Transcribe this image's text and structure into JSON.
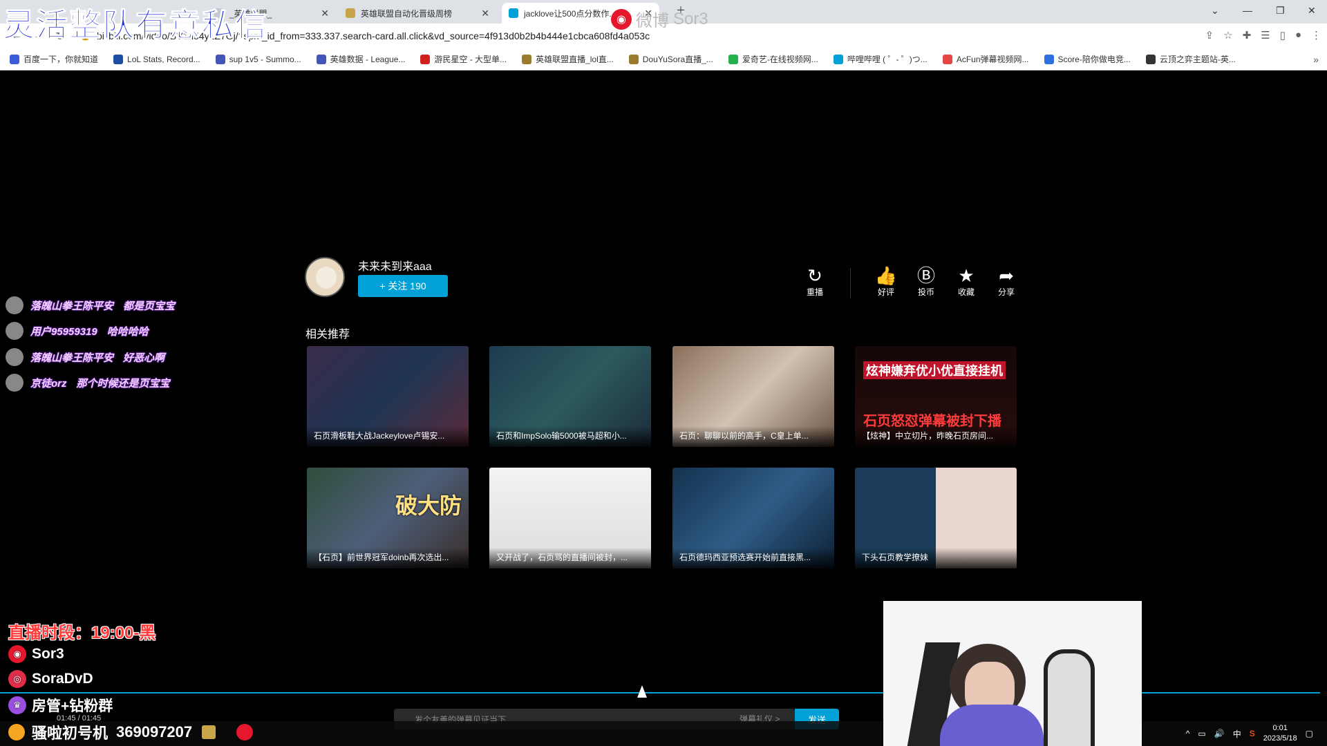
{
  "overlay": {
    "title": "灵活整队有意私信",
    "weibo_badge": "微博",
    "weibo_name": "Sor3"
  },
  "browser": {
    "tabs": [
      {
        "label": "_英雄联盟_"
      },
      {
        "label": "英雄联盟自动化晋级周榜"
      },
      {
        "label": "jacklove让500点分数作..."
      }
    ],
    "url": "bilibili.com/video/BV1h54y1Z7Gj/?spm_id_from=333.337.search-card.all.click&vd_source=4f913d0b2b4b444e1cbca608fd4a053c",
    "bookmarks": [
      {
        "label": "百度一下，你就知道",
        "color": "#3b5bdb"
      },
      {
        "label": "LoL Stats, Record...",
        "color": "#1c4fa3"
      },
      {
        "label": "sup 1v5 - Summo...",
        "color": "#4256b8"
      },
      {
        "label": "英雄数据 - League...",
        "color": "#4256b8"
      },
      {
        "label": "游民星空 - 大型单...",
        "color": "#d01f1f"
      },
      {
        "label": "英雄联盟直播_lol直...",
        "color": "#9a7b2d"
      },
      {
        "label": "DouYuSora直播_...",
        "color": "#9a7b2d"
      },
      {
        "label": "爱奇艺-在线视频网...",
        "color": "#22b14c"
      },
      {
        "label": "哔哩哔哩 ( ゜- ゜)つ...",
        "color": "#00a1d6"
      },
      {
        "label": "AcFun弹幕视频网...",
        "color": "#e44545"
      },
      {
        "label": "Score-陪你做电竞...",
        "color": "#2f6fe0"
      },
      {
        "label": "云顶之弈主题站-英...",
        "color": "#333333"
      }
    ]
  },
  "uploader": {
    "name": "未来未到来aaa",
    "follow_label": "+ 关注 190"
  },
  "actions": {
    "replay": "重播",
    "like": "好评",
    "coin": "投币",
    "favorite": "收藏",
    "share": "分享"
  },
  "related": {
    "title": "相关推荐",
    "videos": [
      {
        "caption": "石页滑板鞋大战Jackeylove卢锡安...",
        "bg": "linear-gradient(135deg,#3a2b4a,#1f3553 50%,#5b2a3a)",
        "overlay_text": ""
      },
      {
        "caption": "石页和ImpSolo输5000被马超和小...",
        "bg": "linear-gradient(135deg,#1e3b4f,#2c5a5e 50%,#1b2c3a)",
        "overlay_text": ""
      },
      {
        "caption": "石页：聊聊以前的高手，C皇上单...",
        "bg": "linear-gradient(135deg,#8a6f5a,#d2c2b2 50%,#6b5443)",
        "overlay_text": ""
      },
      {
        "caption": "【炫神】中立切片，昨晚石页房间...",
        "bg": "linear-gradient(180deg,#140808,#2a0d0d)",
        "overlay_text": "炫神嫌弃优小优直接挂机",
        "overlay_text2": "石页怒怼弹幕被封下播"
      },
      {
        "caption": "【石页】前世界冠军doinb再次选出...",
        "bg": "linear-gradient(135deg,#2e4d3a,#4d5f7a 50%,#3a2e2a)",
        "overlay_text": "破大防"
      },
      {
        "caption": "又开战了，石页骂的直播间被封，...",
        "bg": "linear-gradient(180deg,#f3f3f3,#dcdcdc)",
        "overlay_text": ""
      },
      {
        "caption": "石页德玛西亚预选赛开始前直接黑...",
        "bg": "linear-gradient(135deg,#13324f,#2f5c86 50%,#0d2136)",
        "overlay_text": ""
      },
      {
        "caption": "下头石页教学撩妹",
        "bg": "linear-gradient(90deg,#1a3c5a 50%,#e8d6cf 50%)",
        "overlay_text": ""
      }
    ]
  },
  "danmaku": [
    {
      "user": "落魄山拳王陈平安",
      "msg": "都是页宝宝"
    },
    {
      "user": "用户95959319",
      "msg": "哈哈哈哈"
    },
    {
      "user": "落魄山拳王陈平安",
      "msg": "好恶心啊"
    },
    {
      "user": "京徒orz",
      "msg": "那个时候还是页宝宝"
    }
  ],
  "stream_info": {
    "live_time": "直播时段：19:00-黑",
    "weibo": "Sor3",
    "douyin": "SoraDvD",
    "group": "房管+钻粉群",
    "qq_label": "骚啦初号机",
    "qq_number": "369097207"
  },
  "player": {
    "time": "01:45 / 01:45",
    "danmaku_placeholder": "发个友善的弹幕见证当下",
    "etiquette": "弹幕礼仪 >",
    "send": "发送"
  },
  "taskbar": {
    "ime": "中",
    "time": "0:01",
    "date": "2023/5/18"
  },
  "colors": {
    "accent": "#00a1d6",
    "overlay_blue": "#1d2ad8",
    "live_red": "#ff3b3b"
  }
}
